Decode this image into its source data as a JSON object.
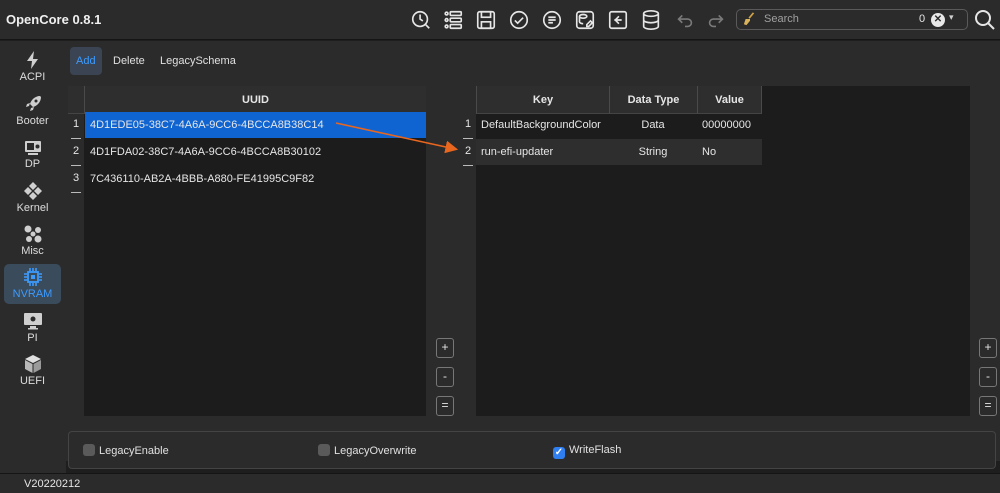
{
  "app": {
    "title": "OpenCore 0.8.1",
    "version": "V20220212"
  },
  "toolbar": {
    "icons": [
      "clock-search-icon",
      "list-icon",
      "save-icon",
      "check-icon",
      "list-check-icon",
      "database-edit-icon",
      "import-icon",
      "database-icon",
      "undo-icon",
      "redo-icon"
    ],
    "search": {
      "placeholder": "Search",
      "count": "0",
      "clear": "✕",
      "dropdown": "▾"
    }
  },
  "sidebar": {
    "items": [
      {
        "label": "ACPI",
        "icon": "bolt-icon"
      },
      {
        "label": "Booter",
        "icon": "rocket-icon"
      },
      {
        "label": "DP",
        "icon": "device-icon"
      },
      {
        "label": "Kernel",
        "icon": "puzzle-icon"
      },
      {
        "label": "Misc",
        "icon": "misc-icon"
      },
      {
        "label": "NVRAM",
        "icon": "chip-icon",
        "active": true
      },
      {
        "label": "PI",
        "icon": "mac-icon"
      },
      {
        "label": "UEFI",
        "icon": "cube-icon"
      }
    ]
  },
  "tabs": [
    {
      "label": "Add",
      "active": true
    },
    {
      "label": "Delete"
    },
    {
      "label": "LegacySchema"
    }
  ],
  "uuid_table": {
    "header": "UUID",
    "rows": [
      {
        "num": "1",
        "uuid": "4D1EDE05-38C7-4A6A-9CC6-4BCCA8B38C14",
        "selected": true
      },
      {
        "num": "2",
        "uuid": "4D1FDA02-38C7-4A6A-9CC6-4BCCA8B30102"
      },
      {
        "num": "3",
        "uuid": "7C436110-AB2A-4BBB-A880-FE41995C9F82"
      }
    ]
  },
  "kv_table": {
    "headers": {
      "key": "Key",
      "type": "Data Type",
      "value": "Value"
    },
    "rows": [
      {
        "num": "1",
        "key": "DefaultBackgroundColor",
        "type": "Data",
        "value": "00000000"
      },
      {
        "num": "2",
        "key": "run-efi-updater",
        "type": "String",
        "value": "No"
      }
    ]
  },
  "buttons": {
    "add": "+",
    "remove": "-",
    "copy": "="
  },
  "options": {
    "legacy_enable": {
      "label": "LegacyEnable",
      "checked": false
    },
    "legacy_overwrite": {
      "label": "LegacyOverwrite",
      "checked": false
    },
    "write_flash": {
      "label": "WriteFlash",
      "checked": true,
      "mark": "✓"
    }
  },
  "colors": {
    "accent": "#3c9bff",
    "selection": "#0f64d2",
    "arrow": "#e8661e"
  }
}
